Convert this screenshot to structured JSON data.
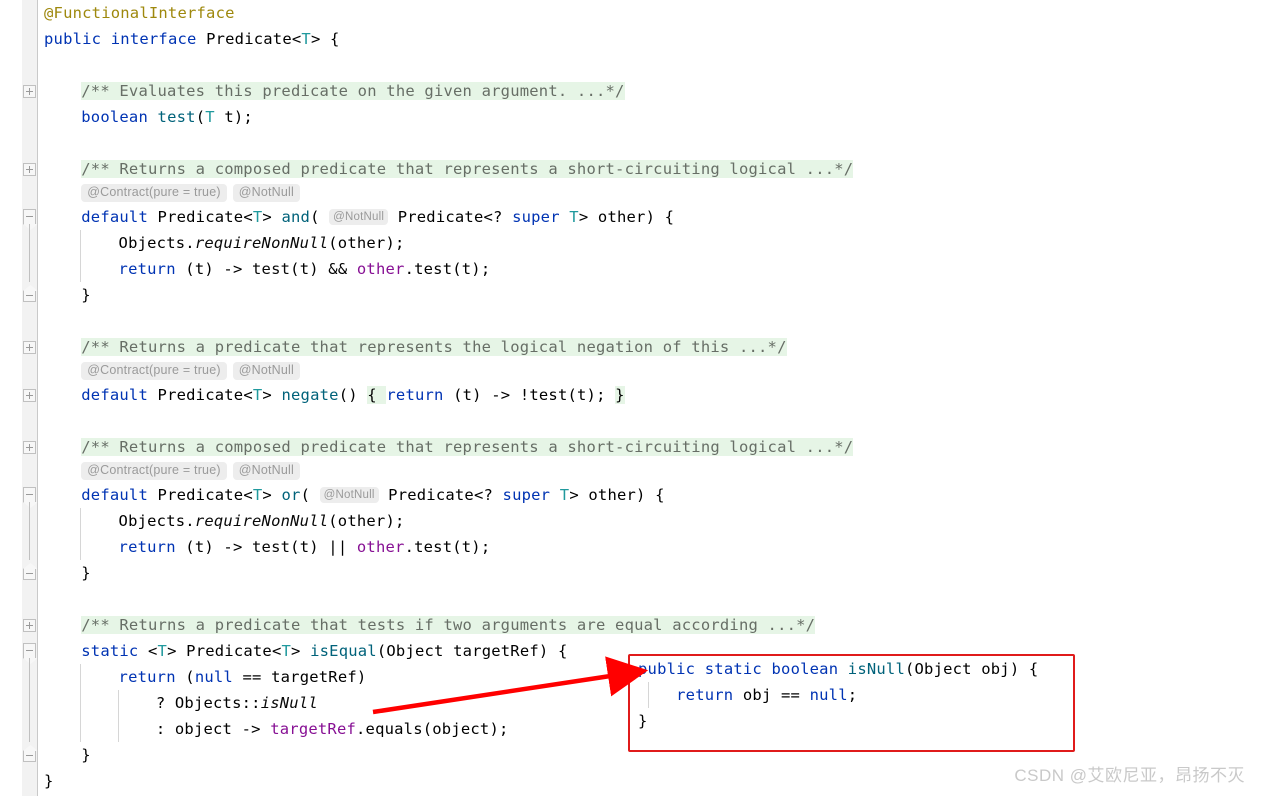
{
  "editor": {
    "language": "java",
    "file_type": "interface",
    "background_color": "#ffffff",
    "comment_highlight_color": "#E6F5E6",
    "callout_border_color": "#E01B1B",
    "arrow_color": "#FF0000",
    "colors": {
      "keyword": "#0033B3",
      "type": "#20999D",
      "method": "#00627A",
      "parameter": "#871094",
      "annotation": "#9E880D",
      "comment_text": "#676E66",
      "plain": "#080808",
      "inlay_hint_text": "#9A9A9A",
      "inlay_hint_bg": "#EDEDED",
      "gutter_bg": "#f2f2f2",
      "indent_guide": "#D6D6D6",
      "watermark": "#C9C9C9"
    },
    "lines": [
      {
        "indent": 0,
        "segments": [
          {
            "t": "@FunctionalInterface",
            "c": "anno"
          }
        ]
      },
      {
        "indent": 0,
        "segments": [
          {
            "t": "public",
            "c": "kw"
          },
          {
            "t": " "
          },
          {
            "t": "interface",
            "c": "kw"
          },
          {
            "t": " Predicate<"
          },
          {
            "t": "T",
            "c": "type"
          },
          {
            "t": "> {"
          }
        ]
      },
      {
        "indent": 0,
        "segments": []
      },
      {
        "indent": 1,
        "segments": [
          {
            "t": "/** Evaluates this predicate on the given argument. ...*/",
            "c": "comment"
          }
        ]
      },
      {
        "indent": 1,
        "segments": [
          {
            "t": "boolean",
            "c": "kw"
          },
          {
            "t": " "
          },
          {
            "t": "test",
            "c": "method"
          },
          {
            "t": "("
          },
          {
            "t": "T",
            "c": "type"
          },
          {
            "t": " t);"
          }
        ]
      },
      {
        "indent": 0,
        "segments": []
      },
      {
        "indent": 1,
        "segments": [
          {
            "t": "/** Returns a composed predicate that represents a short-circuiting logical ...*/",
            "c": "comment"
          }
        ]
      },
      {
        "indent": 1,
        "hints": [
          "@Contract(pure = true)",
          "@NotNull"
        ]
      },
      {
        "indent": 1,
        "segments": [
          {
            "t": "default",
            "c": "kw"
          },
          {
            "t": " Predicate<"
          },
          {
            "t": "T",
            "c": "type"
          },
          {
            "t": "> "
          },
          {
            "t": "and",
            "c": "method"
          },
          {
            "t": "( "
          },
          {
            "t": "@NotNull",
            "c": "pill-inline"
          },
          {
            "t": " Predicate<? "
          },
          {
            "t": "super",
            "c": "kw"
          },
          {
            "t": " "
          },
          {
            "t": "T",
            "c": "type"
          },
          {
            "t": "> other) {"
          }
        ]
      },
      {
        "indent": 2,
        "segments": [
          {
            "t": "Objects."
          },
          {
            "t": "requireNonNull",
            "c": "static"
          },
          {
            "t": "(other);"
          }
        ]
      },
      {
        "indent": 2,
        "segments": [
          {
            "t": "return",
            "c": "kw"
          },
          {
            "t": " (t) -> "
          },
          {
            "t": "test",
            "c": "plain"
          },
          {
            "t": "(t) && "
          },
          {
            "t": "other",
            "c": "param"
          },
          {
            "t": ".test(t);"
          }
        ]
      },
      {
        "indent": 1,
        "segments": [
          {
            "t": "}"
          }
        ]
      },
      {
        "indent": 0,
        "segments": []
      },
      {
        "indent": 1,
        "segments": [
          {
            "t": "/** Returns a predicate that represents the logical negation of this ...*/",
            "c": "comment"
          }
        ]
      },
      {
        "indent": 1,
        "hints": [
          "@Contract(pure = true)",
          "@NotNull"
        ]
      },
      {
        "indent": 1,
        "segments": [
          {
            "t": "default",
            "c": "kw"
          },
          {
            "t": " Predicate<"
          },
          {
            "t": "T",
            "c": "type"
          },
          {
            "t": "> "
          },
          {
            "t": "negate",
            "c": "method"
          },
          {
            "t": "() "
          },
          {
            "t": "{ ",
            "c": "foldmark"
          },
          {
            "t": "return",
            "c": "kw"
          },
          {
            "t": " (t) -> !test(t); "
          },
          {
            "t": "}",
            "c": "foldmark"
          }
        ]
      },
      {
        "indent": 0,
        "segments": []
      },
      {
        "indent": 1,
        "segments": [
          {
            "t": "/** Returns a composed predicate that represents a short-circuiting logical ...*/",
            "c": "comment"
          }
        ]
      },
      {
        "indent": 1,
        "hints": [
          "@Contract(pure = true)",
          "@NotNull"
        ]
      },
      {
        "indent": 1,
        "segments": [
          {
            "t": "default",
            "c": "kw"
          },
          {
            "t": " Predicate<"
          },
          {
            "t": "T",
            "c": "type"
          },
          {
            "t": "> "
          },
          {
            "t": "or",
            "c": "method"
          },
          {
            "t": "( "
          },
          {
            "t": "@NotNull",
            "c": "pill-inline"
          },
          {
            "t": " Predicate<? "
          },
          {
            "t": "super",
            "c": "kw"
          },
          {
            "t": " "
          },
          {
            "t": "T",
            "c": "type"
          },
          {
            "t": "> other) {"
          }
        ]
      },
      {
        "indent": 2,
        "segments": [
          {
            "t": "Objects."
          },
          {
            "t": "requireNonNull",
            "c": "static"
          },
          {
            "t": "(other);"
          }
        ]
      },
      {
        "indent": 2,
        "segments": [
          {
            "t": "return",
            "c": "kw"
          },
          {
            "t": " (t) -> "
          },
          {
            "t": "test",
            "c": "plain"
          },
          {
            "t": "(t) || "
          },
          {
            "t": "other",
            "c": "param"
          },
          {
            "t": ".test(t);"
          }
        ]
      },
      {
        "indent": 1,
        "segments": [
          {
            "t": "}"
          }
        ]
      },
      {
        "indent": 0,
        "segments": []
      },
      {
        "indent": 1,
        "segments": [
          {
            "t": "/** Returns a predicate that tests if two arguments are equal according ...*/",
            "c": "comment"
          }
        ]
      },
      {
        "indent": 1,
        "segments": [
          {
            "t": "static",
            "c": "kw"
          },
          {
            "t": " <"
          },
          {
            "t": "T",
            "c": "type"
          },
          {
            "t": "> Predicate<"
          },
          {
            "t": "T",
            "c": "type"
          },
          {
            "t": "> "
          },
          {
            "t": "isEqual",
            "c": "method"
          },
          {
            "t": "(Object targetRef) {"
          }
        ]
      },
      {
        "indent": 2,
        "segments": [
          {
            "t": "return",
            "c": "kw"
          },
          {
            "t": " ("
          },
          {
            "t": "null",
            "c": "kw"
          },
          {
            "t": " == targetRef)"
          }
        ]
      },
      {
        "indent": 3,
        "segments": [
          {
            "t": "? Objects::"
          },
          {
            "t": "isNull",
            "c": "static"
          }
        ]
      },
      {
        "indent": 3,
        "segments": [
          {
            "t": ": object -> "
          },
          {
            "t": "targetRef",
            "c": "param"
          },
          {
            "t": ".equals(object);"
          }
        ]
      },
      {
        "indent": 1,
        "segments": [
          {
            "t": "}"
          }
        ]
      },
      {
        "indent": 0,
        "segments": [
          {
            "t": "}"
          }
        ]
      }
    ]
  },
  "callout": {
    "label": "isNull-source-callout",
    "lines": [
      [
        {
          "t": "public",
          "c": "kw"
        },
        {
          "t": " "
        },
        {
          "t": "static",
          "c": "kw"
        },
        {
          "t": " "
        },
        {
          "t": "boolean",
          "c": "kw"
        },
        {
          "t": " "
        },
        {
          "t": "isNull",
          "c": "method"
        },
        {
          "t": "(Object obj) {"
        }
      ],
      [
        {
          "t": "    "
        },
        {
          "t": "return",
          "c": "kw"
        },
        {
          "t": " obj == "
        },
        {
          "t": "null",
          "c": "kw"
        },
        {
          "t": ";"
        }
      ],
      [
        {
          "t": "}"
        }
      ]
    ]
  },
  "watermark": {
    "text": "CSDN @艾欧尼亚，昂扬不灭"
  }
}
